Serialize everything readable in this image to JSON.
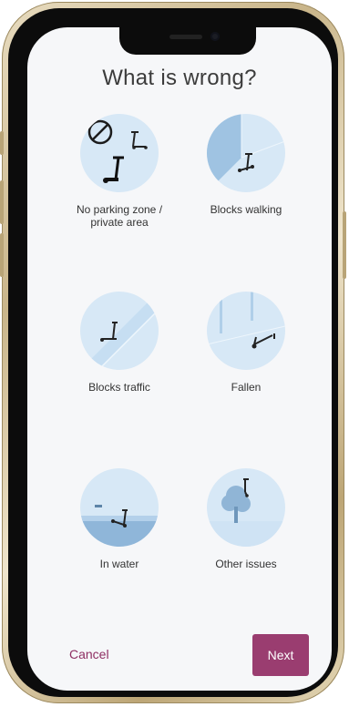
{
  "screen": {
    "title": "What is wrong?",
    "options": [
      {
        "label_line1": "No parking zone /",
        "label_line2": "private area",
        "icon": "no-parking-icon"
      },
      {
        "label_line1": "Blocks walking",
        "label_line2": "",
        "icon": "walkway-icon"
      },
      {
        "label_line1": "Blocks traffic",
        "label_line2": "",
        "icon": "road-icon"
      },
      {
        "label_line1": "Fallen",
        "label_line2": "",
        "icon": "fallen-scooter-icon"
      },
      {
        "label_line1": "In water",
        "label_line2": "",
        "icon": "water-icon"
      },
      {
        "label_line1": "Other issues",
        "label_line2": "",
        "icon": "tree-icon"
      }
    ],
    "cancel_label": "Cancel",
    "next_label": "Next"
  },
  "colors": {
    "accent": "#9a3d70",
    "cancel_text": "#8e2f63",
    "circle_bg": "#d7e8f6",
    "screen_bg": "#f6f7f9"
  }
}
